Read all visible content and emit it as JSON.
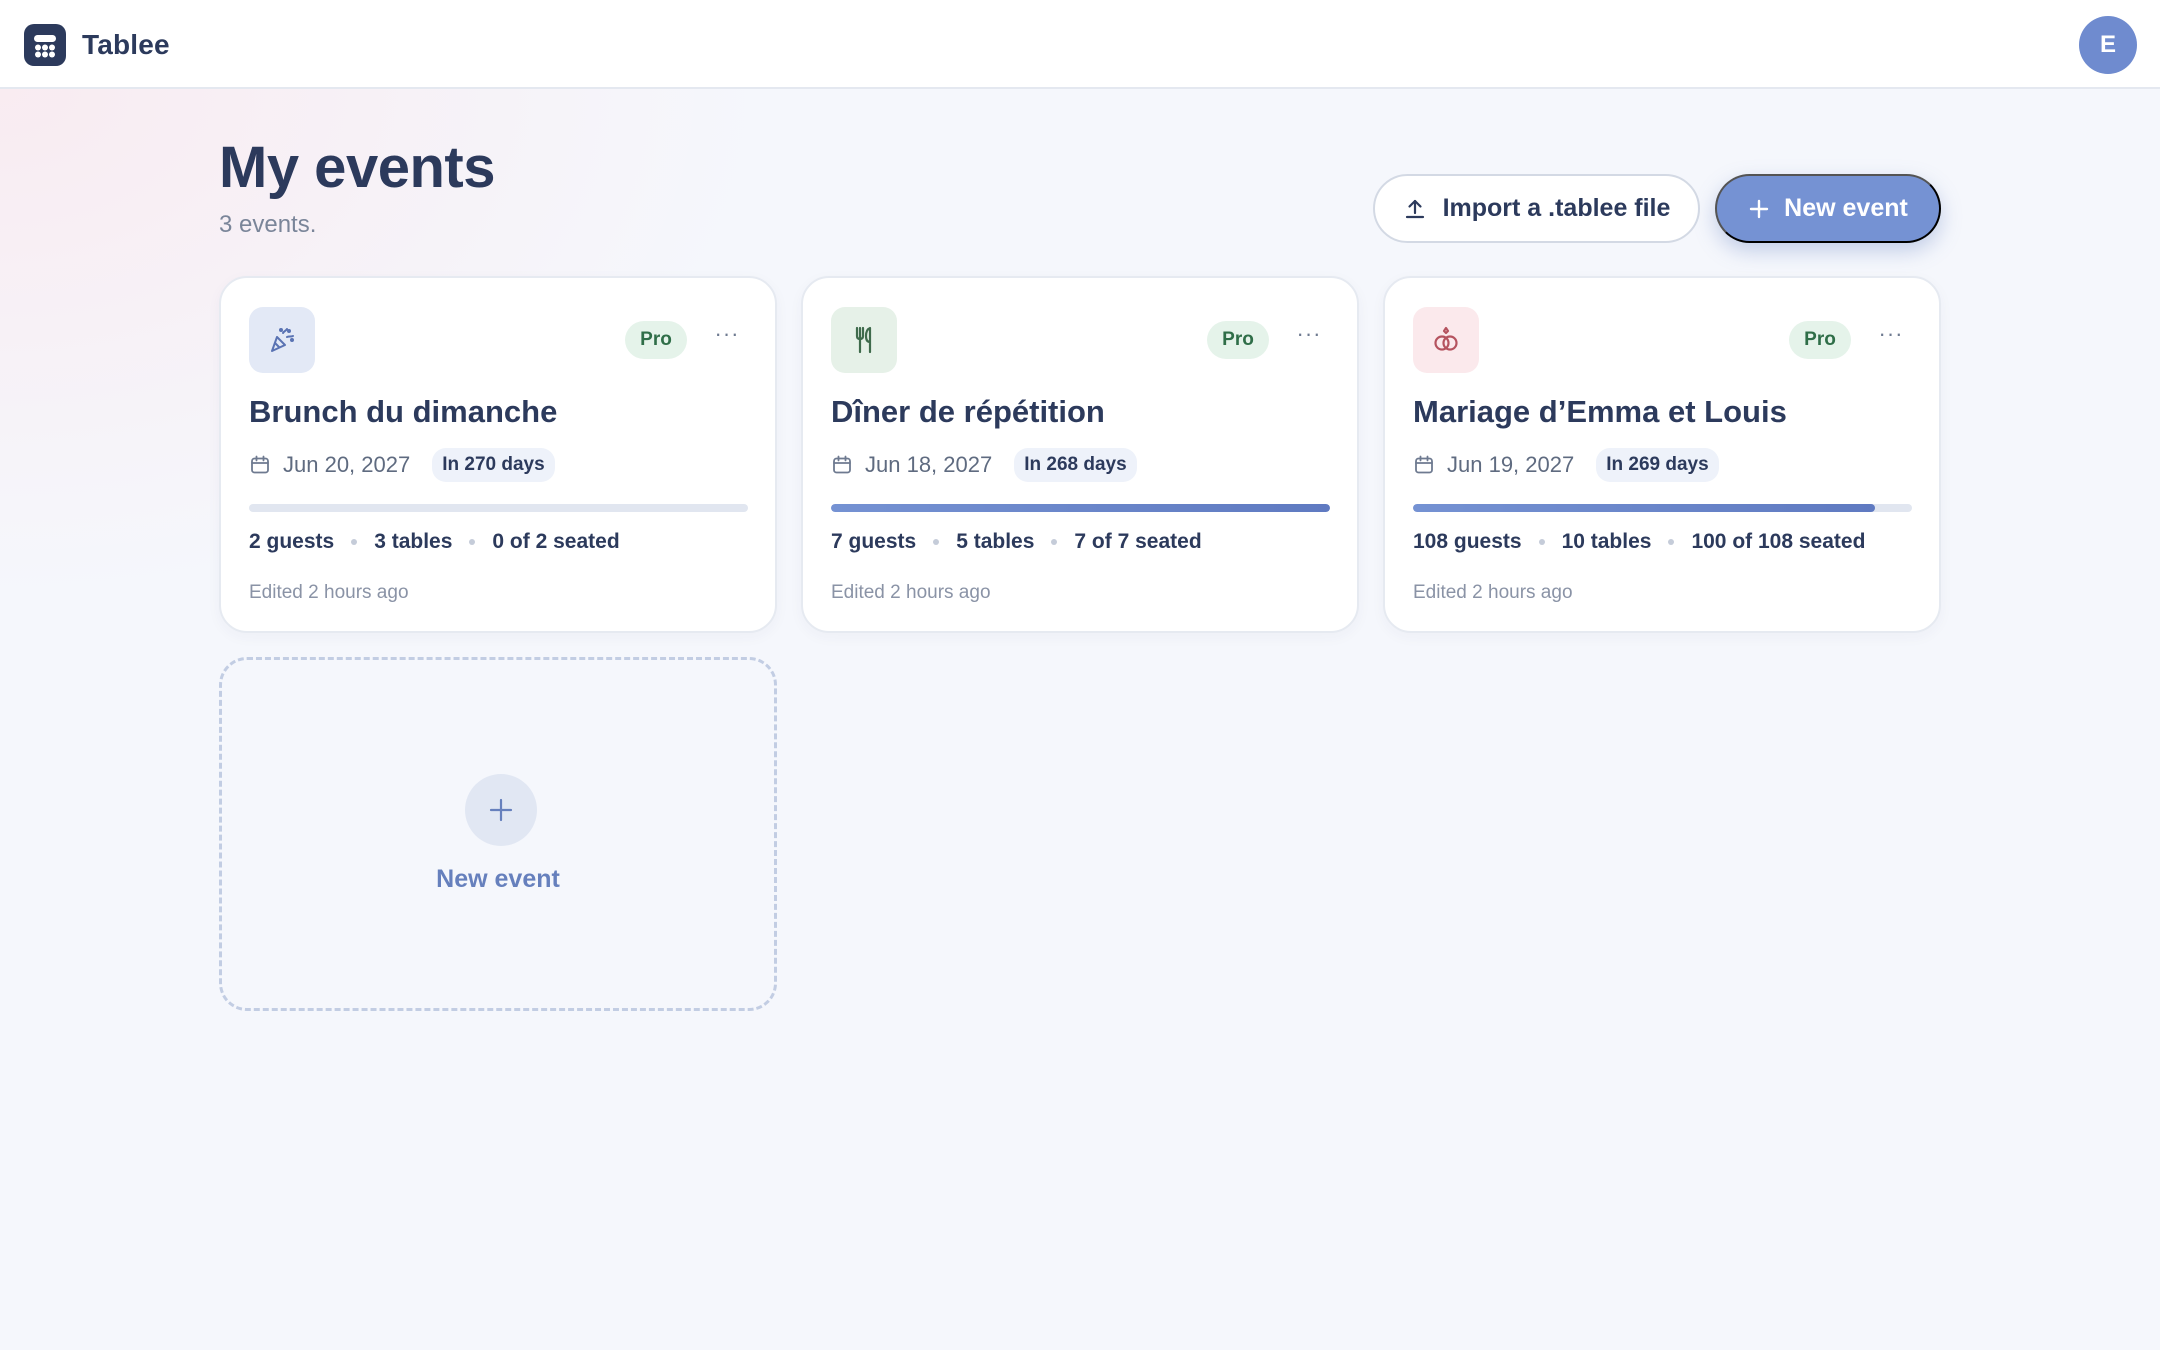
{
  "app": {
    "name": "Tablee",
    "user_initial": "E"
  },
  "page": {
    "title": "My events",
    "subtitle": "3 events.",
    "import_label": "Import a .tablee file",
    "new_event_label": "New event"
  },
  "events": [
    {
      "icon": "party-popper-icon",
      "icon_bg": "#e3e9f6",
      "icon_color": "#5a73b3",
      "badge": "Pro",
      "title": "Brunch du dimanche",
      "date": "Jun 20, 2027",
      "countdown": "In 270 days",
      "seated_fraction": 0,
      "guests": "2 guests",
      "tables": "3 tables",
      "seated": "0 of 2 seated",
      "edited": "Edited 2 hours ago"
    },
    {
      "icon": "fork-knife-icon",
      "icon_bg": "#e6f1e8",
      "icon_color": "#3f6b4c",
      "badge": "Pro",
      "title": "Dîner de répétition",
      "date": "Jun 18, 2027",
      "countdown": "In 268 days",
      "seated_fraction": 1,
      "guests": "7 guests",
      "tables": "5 tables",
      "seated": "7 of 7 seated",
      "edited": "Edited 2 hours ago"
    },
    {
      "icon": "rings-icon",
      "icon_bg": "#fbe9ec",
      "icon_color": "#b5535f",
      "badge": "Pro",
      "title": "Mariage d’Emma et Louis",
      "date": "Jun 19, 2027",
      "countdown": "In 269 days",
      "seated_fraction": 0.926,
      "guests": "108 guests",
      "tables": "10 tables",
      "seated": "100 of 108 seated",
      "edited": "Edited 2 hours ago"
    }
  ],
  "new_card": {
    "label": "New event"
  }
}
